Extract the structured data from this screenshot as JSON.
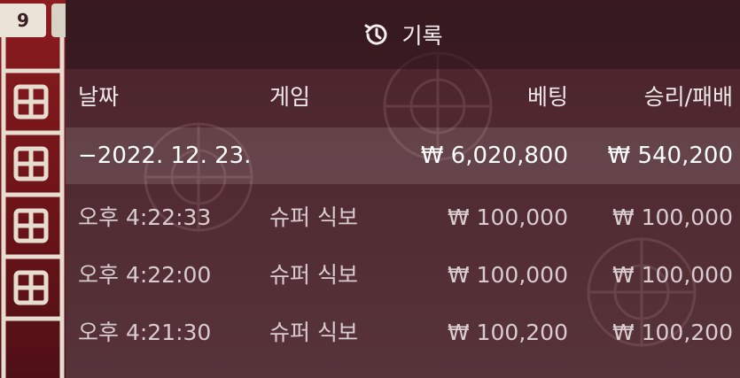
{
  "board": {
    "badge_number": "9"
  },
  "history": {
    "title": "기록",
    "columns": {
      "date": "날짜",
      "game": "게임",
      "bet": "베팅",
      "result": "승리/패배"
    },
    "day_group": {
      "date": "−2022. 12. 23.",
      "total_bet": "₩ 6,020,800",
      "total_result": "₩ 540,200"
    },
    "rows": [
      {
        "time": "오후 4:22:33",
        "game": "슈퍼 식보",
        "bet": "₩ 100,000",
        "result": "₩ 100,000"
      },
      {
        "time": "오후 4:22:00",
        "game": "슈퍼 식보",
        "bet": "₩ 100,000",
        "result": "₩ 100,000"
      },
      {
        "time": "오후 4:21:30",
        "game": "슈퍼 식보",
        "bet": "₩ 100,200",
        "result": "₩ 100,200"
      }
    ]
  },
  "colors": {
    "panel": "#4f2a30",
    "header_bar": "#2e151b",
    "board_red": "#8c1c1f",
    "lattice": "#e6ddd0"
  },
  "icons": {
    "history": "history-clock-icon"
  }
}
